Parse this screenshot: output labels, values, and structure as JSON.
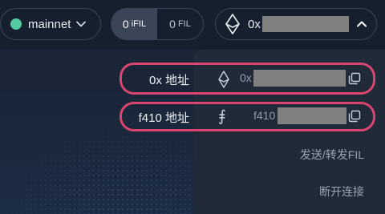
{
  "header": {
    "network": {
      "label": "mainnet",
      "status_color": "#53c9a0"
    },
    "unit_toggle": {
      "active": {
        "value": "0",
        "unit": "iFIL"
      },
      "inactive": {
        "value": "0",
        "unit": "FIL"
      }
    },
    "account": {
      "prefix": "0x",
      "icon": "ethereum-icon"
    }
  },
  "dropdown": {
    "rows": [
      {
        "label": "0x 地址",
        "icon": "ethereum-icon",
        "address_prefix": "0x"
      },
      {
        "label": "f410 地址",
        "icon": "filecoin-icon",
        "icon_glyph": "⨎",
        "address_prefix": "f410"
      }
    ],
    "menu": {
      "send": "发送/转发FIL",
      "disconnect": "断开连接"
    }
  },
  "colors": {
    "highlight": "#d9456e",
    "accent_green": "#53c9a0"
  }
}
